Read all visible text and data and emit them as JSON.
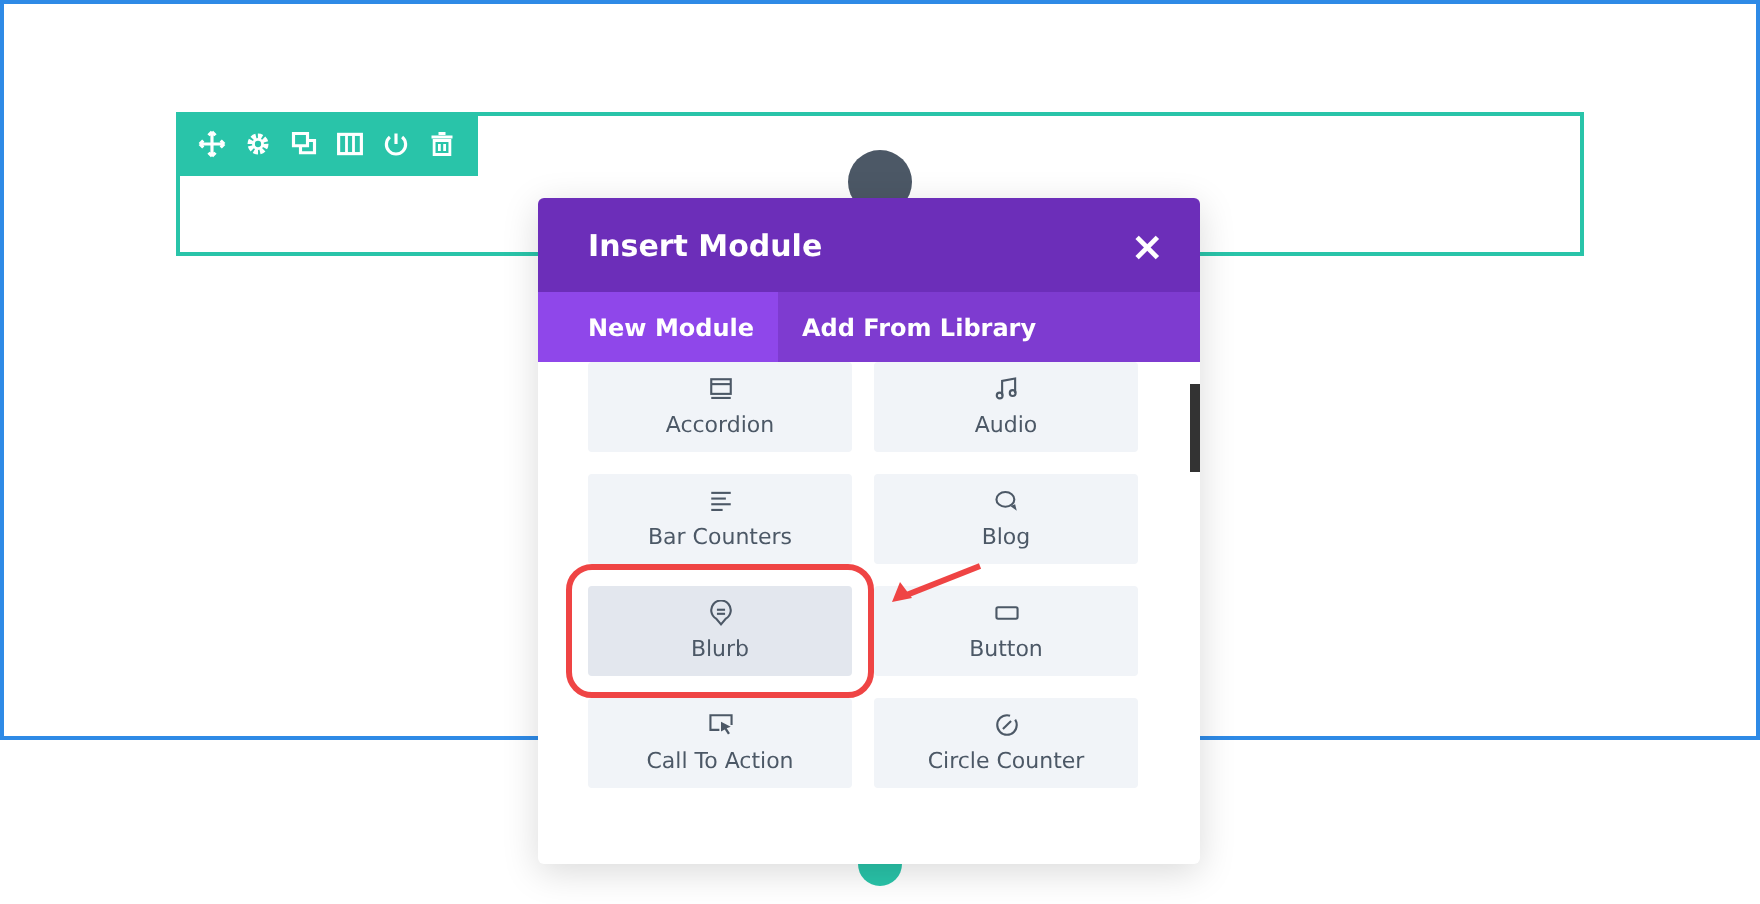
{
  "modal": {
    "title": "Insert Module",
    "close": "×"
  },
  "tabs": [
    {
      "label": "New Module",
      "selected": true
    },
    {
      "label": "Add From Library",
      "selected": false
    }
  ],
  "modules": [
    {
      "label": "Accordion",
      "kind": "accordion",
      "selected": false
    },
    {
      "label": "Audio",
      "kind": "audio",
      "selected": false
    },
    {
      "label": "Bar Counters",
      "kind": "bars",
      "selected": false
    },
    {
      "label": "Blog",
      "kind": "blog",
      "selected": false
    },
    {
      "label": "Blurb",
      "kind": "blurb",
      "selected": true
    },
    {
      "label": "Button",
      "kind": "button",
      "selected": false
    },
    {
      "label": "Call To Action",
      "kind": "cta",
      "selected": false
    },
    {
      "label": "Circle Counter",
      "kind": "circle",
      "selected": false
    }
  ]
}
